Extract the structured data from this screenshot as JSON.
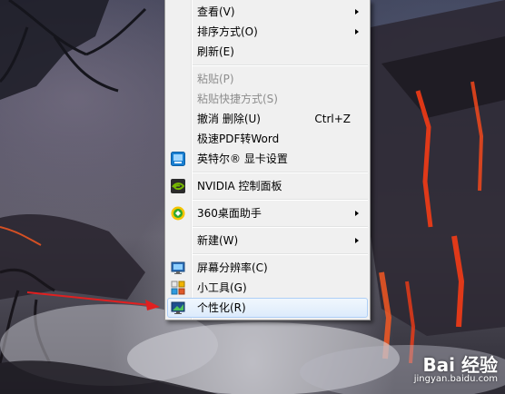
{
  "context_menu": {
    "items": [
      {
        "label": "查看(V)",
        "submenu": true
      },
      {
        "label": "排序方式(O)",
        "submenu": true
      },
      {
        "label": "刷新(E)"
      },
      {
        "label": "粘贴(P)",
        "disabled": true
      },
      {
        "label": "粘贴快捷方式(S)",
        "disabled": true
      },
      {
        "label": "撤消 删除(U)",
        "shortcut": "Ctrl+Z"
      },
      {
        "label": "极速PDF转Word"
      },
      {
        "label": "英特尔® 显卡设置",
        "icon": "intel-graphics-icon"
      },
      {
        "label": "NVIDIA 控制面板",
        "icon": "nvidia-icon"
      },
      {
        "label": "360桌面助手",
        "icon": "360-icon",
        "submenu": true
      },
      {
        "label": "新建(W)",
        "submenu": true
      },
      {
        "label": "屏幕分辨率(C)",
        "icon": "screen-resolution-icon"
      },
      {
        "label": "小工具(G)",
        "icon": "gadgets-icon"
      },
      {
        "label": "个性化(R)",
        "icon": "personalize-icon",
        "highlighted": true
      }
    ]
  },
  "watermark": {
    "brand": "Bai 经验",
    "url": "jingyan.baidu.com"
  },
  "colors": {
    "menu_background": "#f0f0f0",
    "highlight_border": "#aecff7",
    "arrow_red": "#e02020",
    "lava": "#ff4a1a"
  }
}
